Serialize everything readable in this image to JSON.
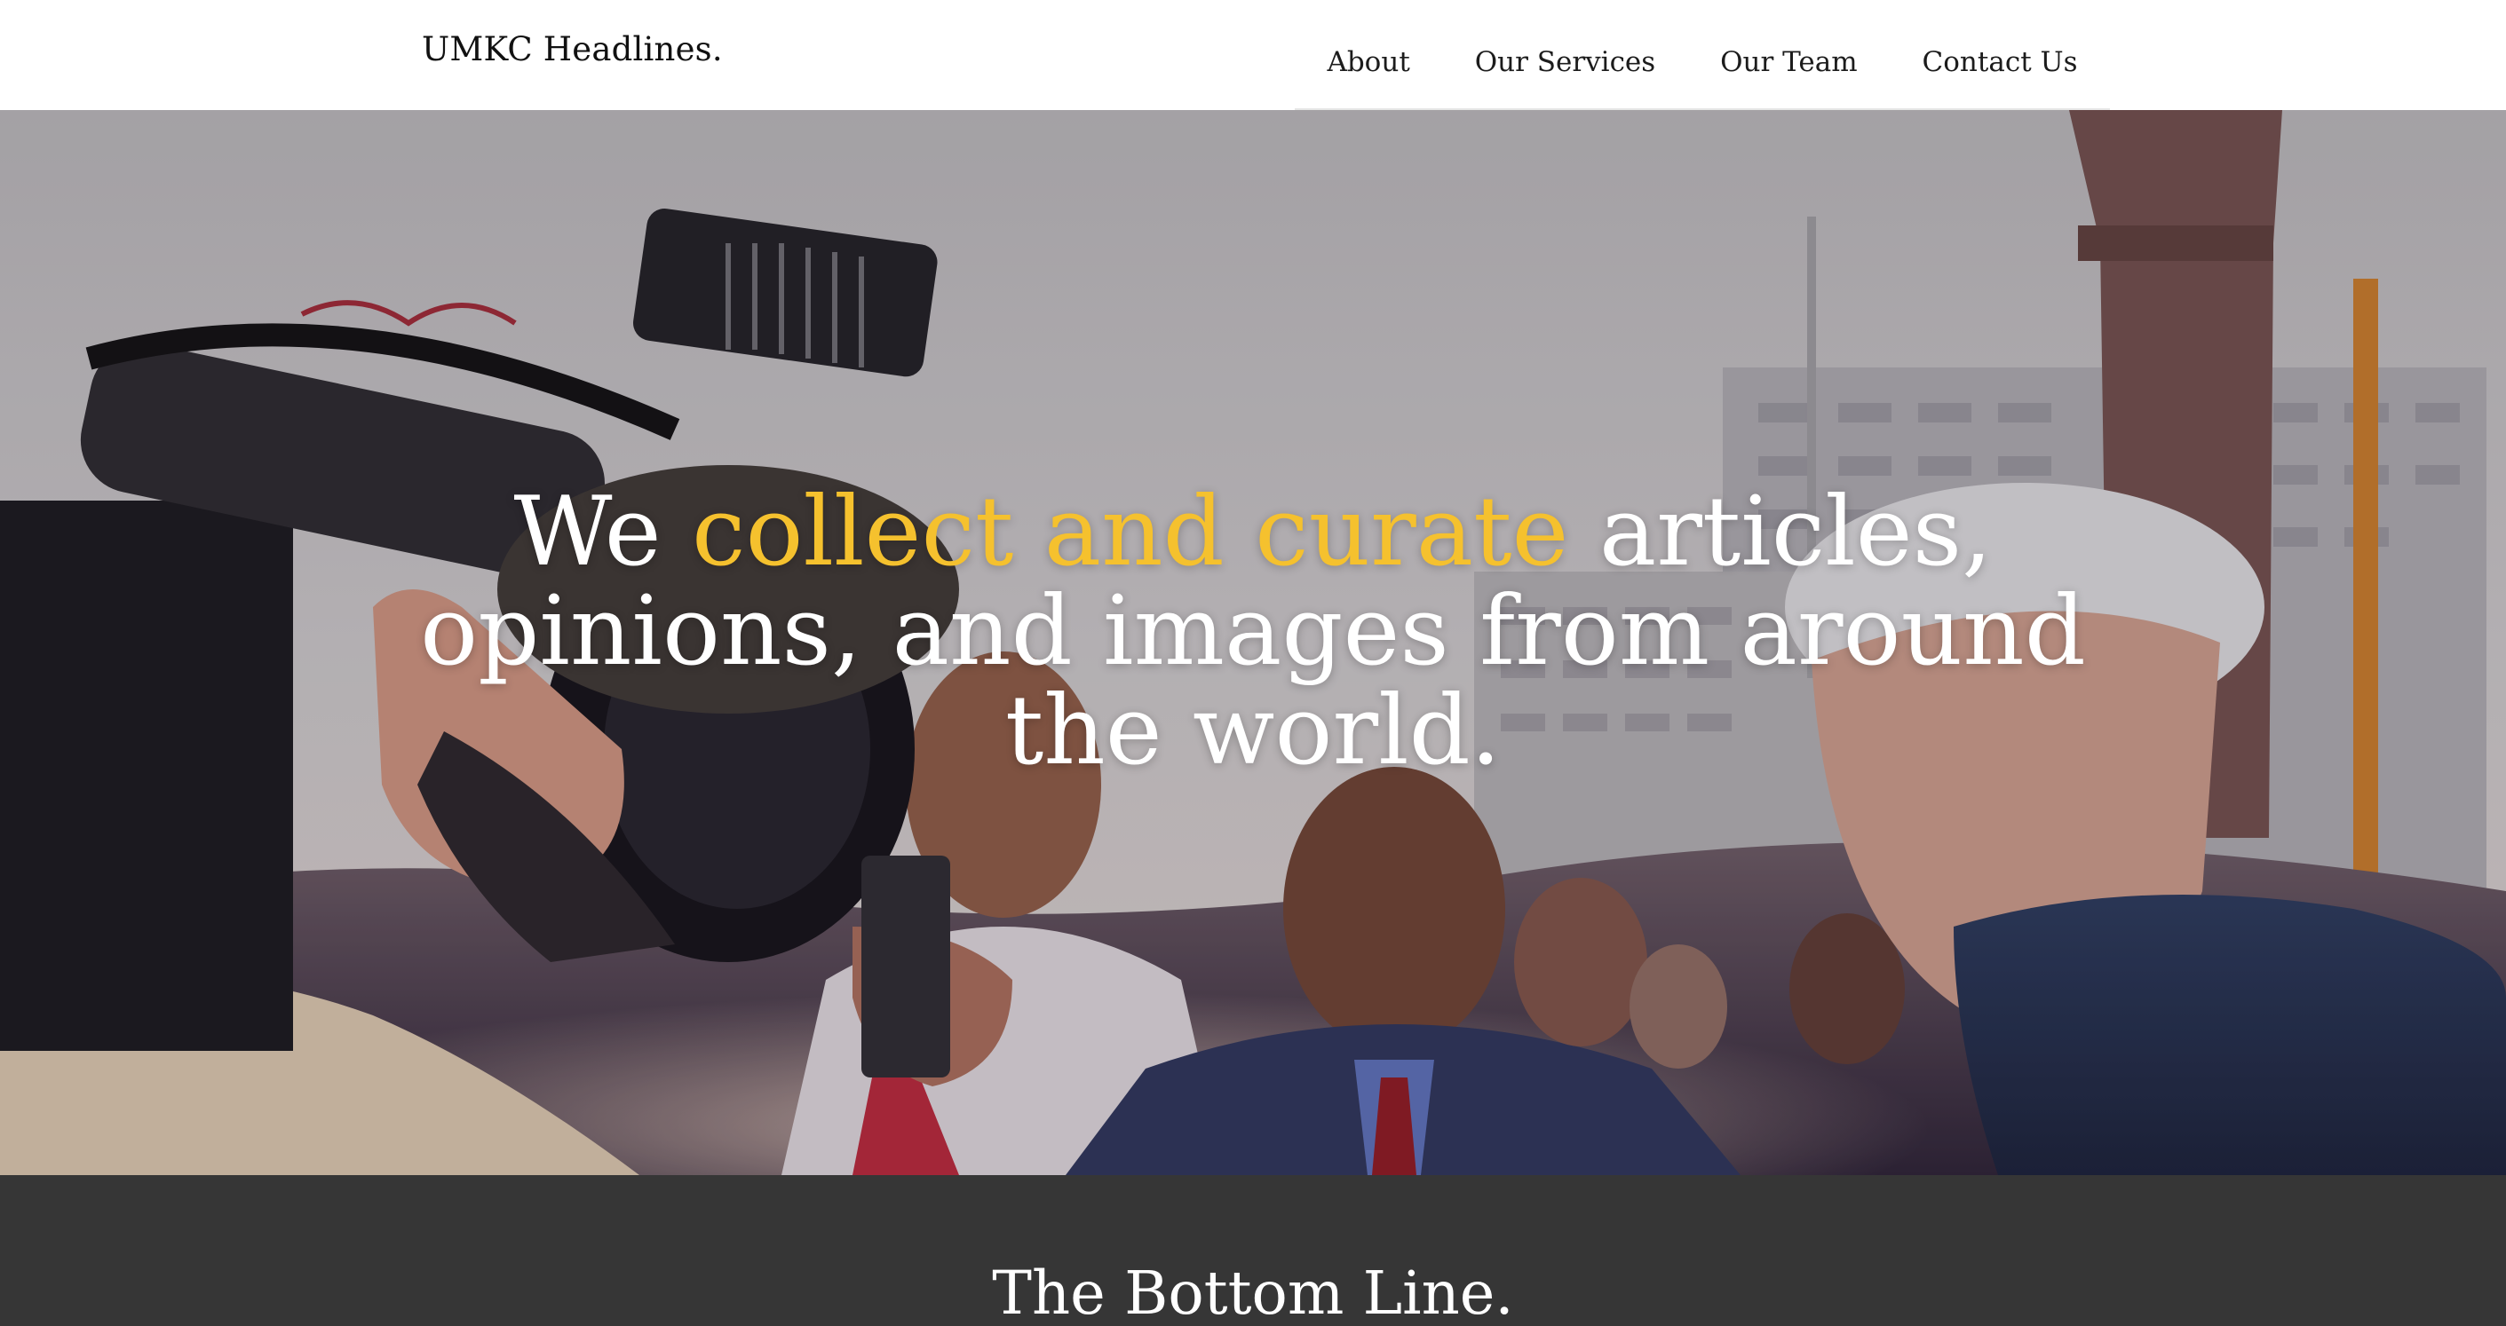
{
  "header": {
    "brand": "UMKC Headlines.",
    "nav": [
      {
        "label": "About"
      },
      {
        "label": "Our Services"
      },
      {
        "label": "Our Team"
      },
      {
        "label": "Contact Us"
      }
    ]
  },
  "hero": {
    "headline_part1": "We ",
    "headline_accent": "collect and curate",
    "headline_part2": " articles, opinions, and images from around the world.",
    "accent_color": "#f5c12e"
  },
  "section": {
    "title": "The Bottom Line."
  },
  "colors": {
    "header_bg": "#ffffff",
    "band_bg": "#363636",
    "text_light": "#ffffff",
    "text_dark": "#1c1c1c"
  }
}
